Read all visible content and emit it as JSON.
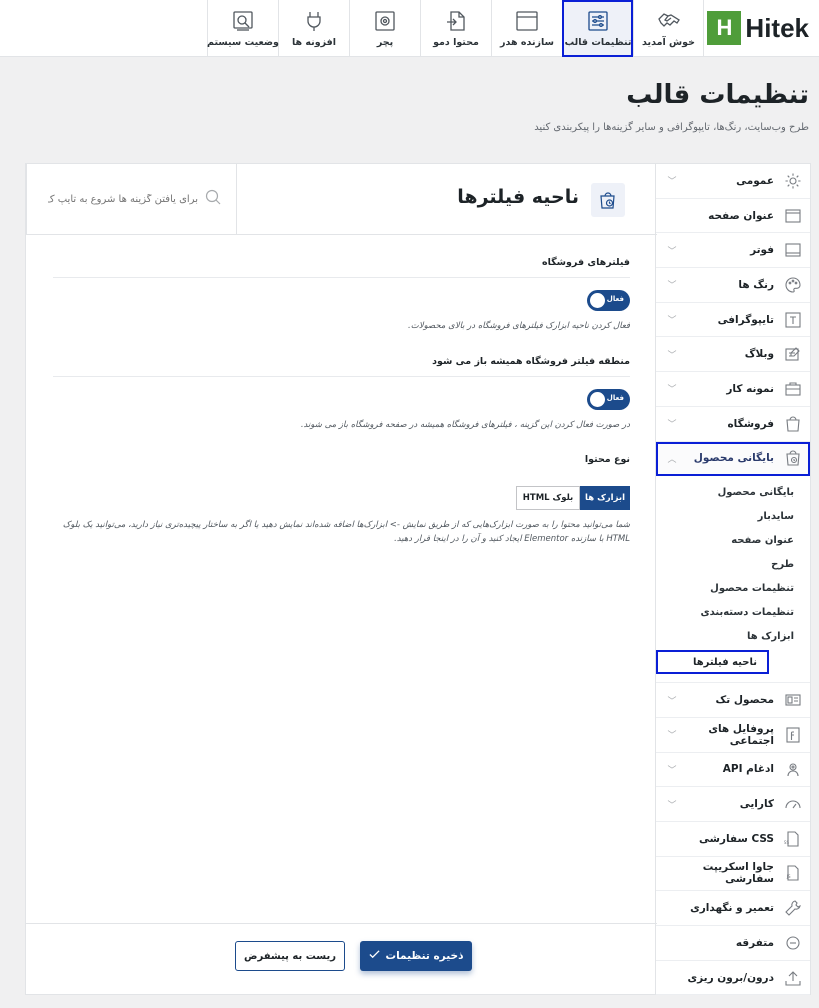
{
  "brand": {
    "mark": "H",
    "name": "Hitek"
  },
  "tabs": [
    {
      "label": "خوش آمدید",
      "icon": "handshake-icon",
      "active": false
    },
    {
      "label": "تنظیمات قالب",
      "icon": "sliders-icon",
      "active": true
    },
    {
      "label": "سازنده هدر",
      "icon": "browser-window-icon",
      "active": false
    },
    {
      "label": "محتوا دمو",
      "icon": "file-import-icon",
      "active": false
    },
    {
      "label": "پچر",
      "icon": "settings-box-icon",
      "active": false
    },
    {
      "label": "افزونه ها",
      "icon": "plug-icon",
      "active": false
    },
    {
      "label": "وضعیت سیستم",
      "icon": "system-status-icon",
      "active": false
    }
  ],
  "page": {
    "title": "تنظیمات قالب",
    "description": "طرح وب‌سایت، رنگ‌ها، تایپوگرافی و سایر گزینه‌ها را پیکربندی کنید"
  },
  "section": {
    "title": "ناحیه فیلترها",
    "icon": "shop-bag-clock-icon"
  },
  "search": {
    "placeholder": "برای یافتن گزینه ها شروع به تایپ ک"
  },
  "sidebar": {
    "items": [
      {
        "label": "عمومی",
        "icon": "gear-icon",
        "chevron": true
      },
      {
        "label": "عنوان صفحه",
        "icon": "page-title-icon",
        "chevron": false
      },
      {
        "label": "فوتر",
        "icon": "footer-icon",
        "chevron": true
      },
      {
        "label": "رنگ ها",
        "icon": "palette-icon",
        "chevron": true
      },
      {
        "label": "تایپوگرافی",
        "icon": "typography-icon",
        "chevron": true
      },
      {
        "label": "وبلاگ",
        "icon": "blog-icon",
        "chevron": true
      },
      {
        "label": "نمونه کار",
        "icon": "briefcase-icon",
        "chevron": true
      },
      {
        "label": "فروشگاه",
        "icon": "shopping-bag-icon",
        "chevron": true
      },
      {
        "label": "بایگانی محصول",
        "icon": "product-archive-icon",
        "chevron": true,
        "active": true
      }
    ],
    "subitems": [
      {
        "label": "بایگانی محصول"
      },
      {
        "label": "سایدبار"
      },
      {
        "label": "عنوان صفحه"
      },
      {
        "label": "طرح"
      },
      {
        "label": "تنظیمات محصول"
      },
      {
        "label": "تنظیمات دسته‌بندی"
      },
      {
        "label": "ابزارک ها"
      },
      {
        "label": "ناحیه فیلترها",
        "active": true
      }
    ],
    "items_after": [
      {
        "label": "محصول تک",
        "icon": "single-product-icon",
        "chevron": true
      },
      {
        "label": "پروفایل های اجتماعی",
        "icon": "social-profile-icon",
        "chevron": true
      },
      {
        "label": "ادغام API",
        "icon": "api-integration-icon",
        "chevron": true
      },
      {
        "label": "کارایی",
        "icon": "speedometer-icon",
        "chevron": true
      },
      {
        "label": "CSS سفارشی",
        "icon": "css-file-icon",
        "chevron": false
      },
      {
        "label": "جاوا اسکریپت سفارشی",
        "icon": "js-file-icon",
        "chevron": false
      },
      {
        "label": "تعمیر و نگهداری",
        "icon": "wrench-icon",
        "chevron": false
      },
      {
        "label": "متفرقه",
        "icon": "circle-minus-icon",
        "chevron": false
      },
      {
        "label": "درون/برون ریزی",
        "icon": "upload-icon",
        "chevron": false
      }
    ]
  },
  "options": {
    "shop_filters": {
      "title": "فیلترهای فروشگاه",
      "toggle_label": "فعال",
      "description": "فعال کردن ناحیه ابزارک فیلترهای فروشگاه در بالای محصولات."
    },
    "always_open": {
      "title": "منطقه فیلتر فروشگاه همیشه باز می شود",
      "toggle_label": "فعال",
      "description": "در صورت فعال کردن این گزینه ، فیلترهای فروشگاه همیشه در صفحه فروشگاه باز می شوند."
    },
    "content_type": {
      "title": "نوع محتوا",
      "options": [
        "ابزارک ها",
        "بلوک HTML"
      ],
      "selected": "ابزارک ها",
      "description": "شما می‌توانید محتوا را به صورت ابزارک‌هایی که از طریق نمایش -> ابزارک‌ها اضافه شده‌اند نمایش دهید یا اگر به ساختار پیچیده‌تری نیاز دارید، می‌توانید یک بلوک HTML با سازنده Elementor ایجاد کنید و آن را در اینجا قرار دهید."
    }
  },
  "footer": {
    "save_label": "ذخیره تنظیمات",
    "reset_label": "ریست به پیشفرض"
  },
  "colors": {
    "accent": "#1c4b8c",
    "brand": "#4f9d3a",
    "highlight": "#0a1fd6"
  }
}
